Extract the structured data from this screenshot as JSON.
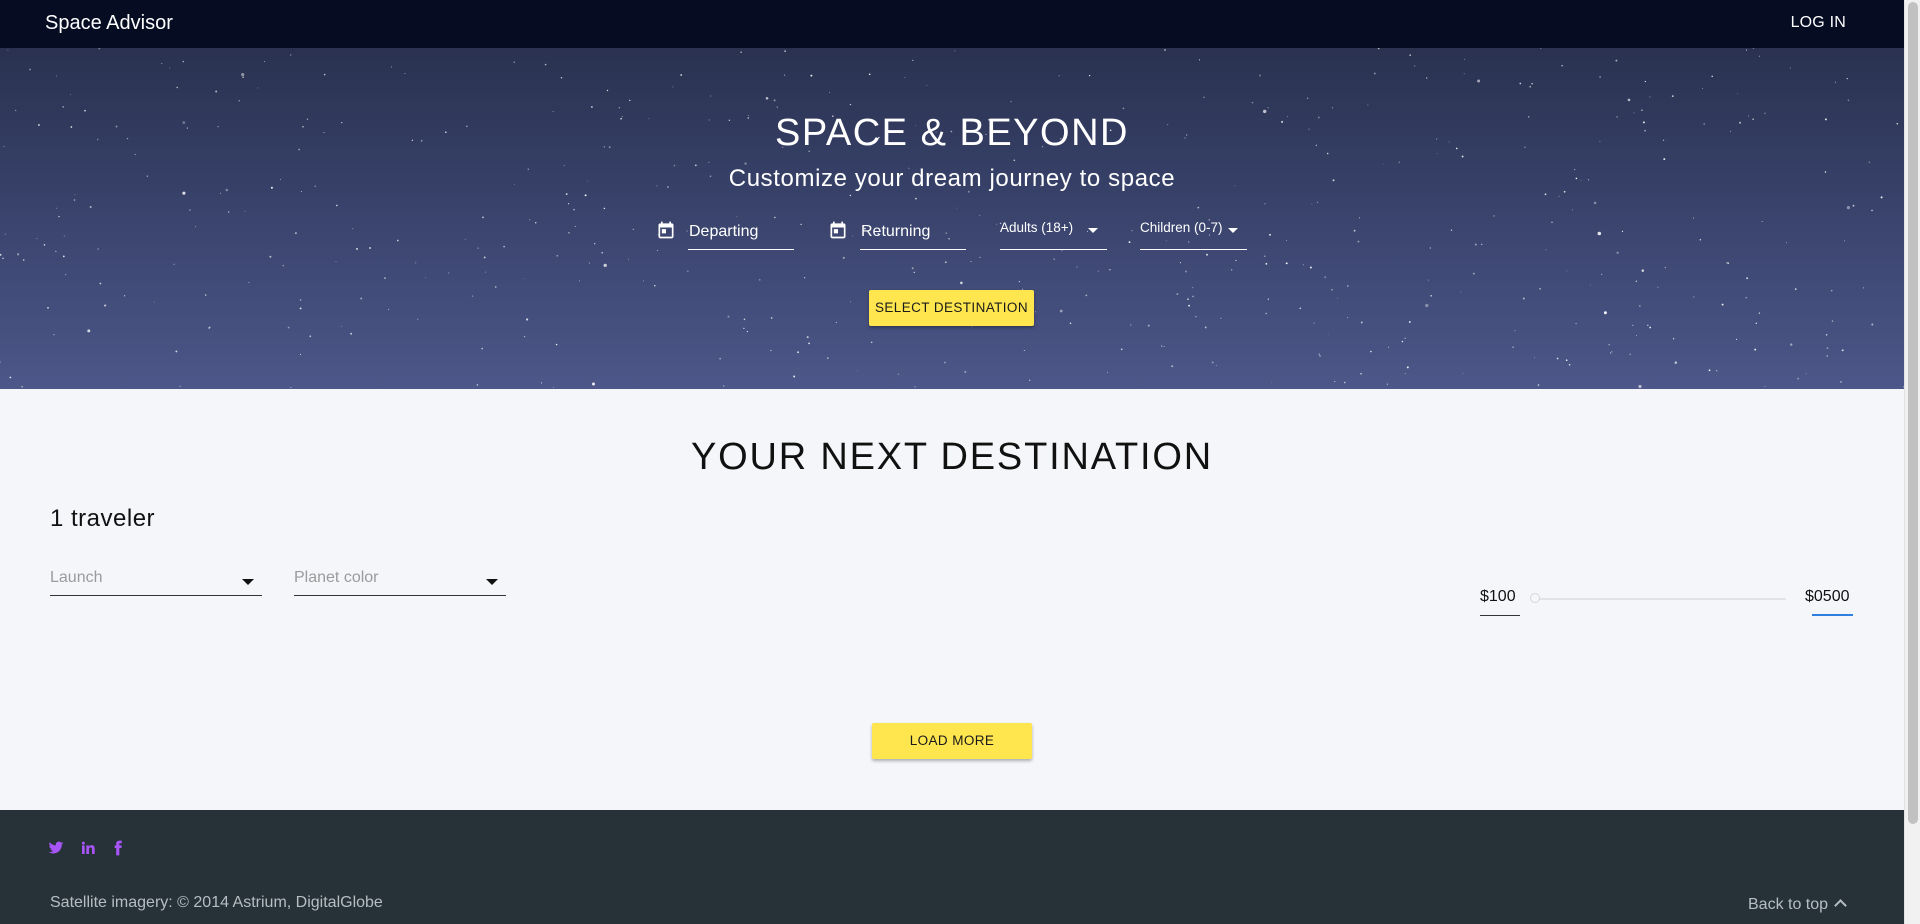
{
  "header": {
    "brand": "Space Advisor",
    "login_label": "LOG IN"
  },
  "hero": {
    "title": "SPACE & BEYOND",
    "subtitle": "Customize your dream journey to space",
    "departing_label": "Departing",
    "returning_label": "Returning",
    "adults_label": "Adults (18+)",
    "children_label": "Children (0-7)",
    "select_destination_label": "SELECT DESTINATION"
  },
  "main": {
    "title": "YOUR NEXT DESTINATION",
    "travelers": "1 traveler",
    "launch_placeholder": "Launch",
    "planet_color_placeholder": "Planet color",
    "price_min": "$100",
    "price_max": "$0500",
    "slider_position": 0,
    "load_more_label": "LOAD MORE"
  },
  "footer": {
    "social_icons": [
      "twitter-icon",
      "linkedin-icon",
      "facebook-icon"
    ],
    "social_color": "#a855f7",
    "credit": "Satellite imagery: © 2014 Astrium, DigitalGlobe",
    "back_to_top": "Back to top"
  },
  "colors": {
    "topbar": "#060d23",
    "accent_yellow": "#ffe64f",
    "footer": "#263238",
    "slider_focus": "#2f7fe0"
  }
}
